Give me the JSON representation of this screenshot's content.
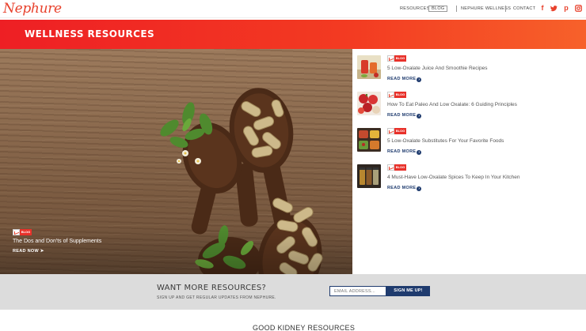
{
  "header": {
    "logo": "Nephure",
    "nav": [
      "RESOURCES",
      "BLOG",
      "NEPHURE WELLNESS",
      "CONTACT"
    ],
    "social_icons": [
      "facebook-icon",
      "twitter-icon",
      "pinterest-icon",
      "instagram-icon"
    ]
  },
  "banner": {
    "title": "WELLNESS RESOURCES"
  },
  "featured": {
    "badge": "BLOG",
    "title": "The Dos and Don'ts of Supplements",
    "read_label": "READ NOW"
  },
  "articles": [
    {
      "badge": "BLOG",
      "title": "5 Low-Oxalate Juice And Smoothie Recipes",
      "read": "READ MORE"
    },
    {
      "badge": "BLOG",
      "title": "How To Eat Paleo And Low Oxalate: 6 Guiding Principles",
      "read": "READ MORE"
    },
    {
      "badge": "BLOG",
      "title": "5 Low-Oxalate Substitutes For Your Favorite Foods",
      "read": "READ MORE"
    },
    {
      "badge": "BLOG",
      "title": "4 Must-Have Low-Oxalate Spices To Keep In Your Kitchen",
      "read": "READ MORE"
    }
  ],
  "newsletter": {
    "title": "WANT MORE RESOURCES?",
    "subtitle": "SIGN UP AND GET REGULAR UPDATES FROM NEPHURE.",
    "email_placeholder": "EMAIL ADDRESS...",
    "button": "SIGN ME UP!"
  },
  "bottom": {
    "title": "GOOD KIDNEY RESOURCES"
  },
  "colors": {
    "brand": "#e8412c",
    "navy": "#1f3b6e",
    "banner_start": "#ee1f24",
    "banner_end": "#f7612a"
  }
}
